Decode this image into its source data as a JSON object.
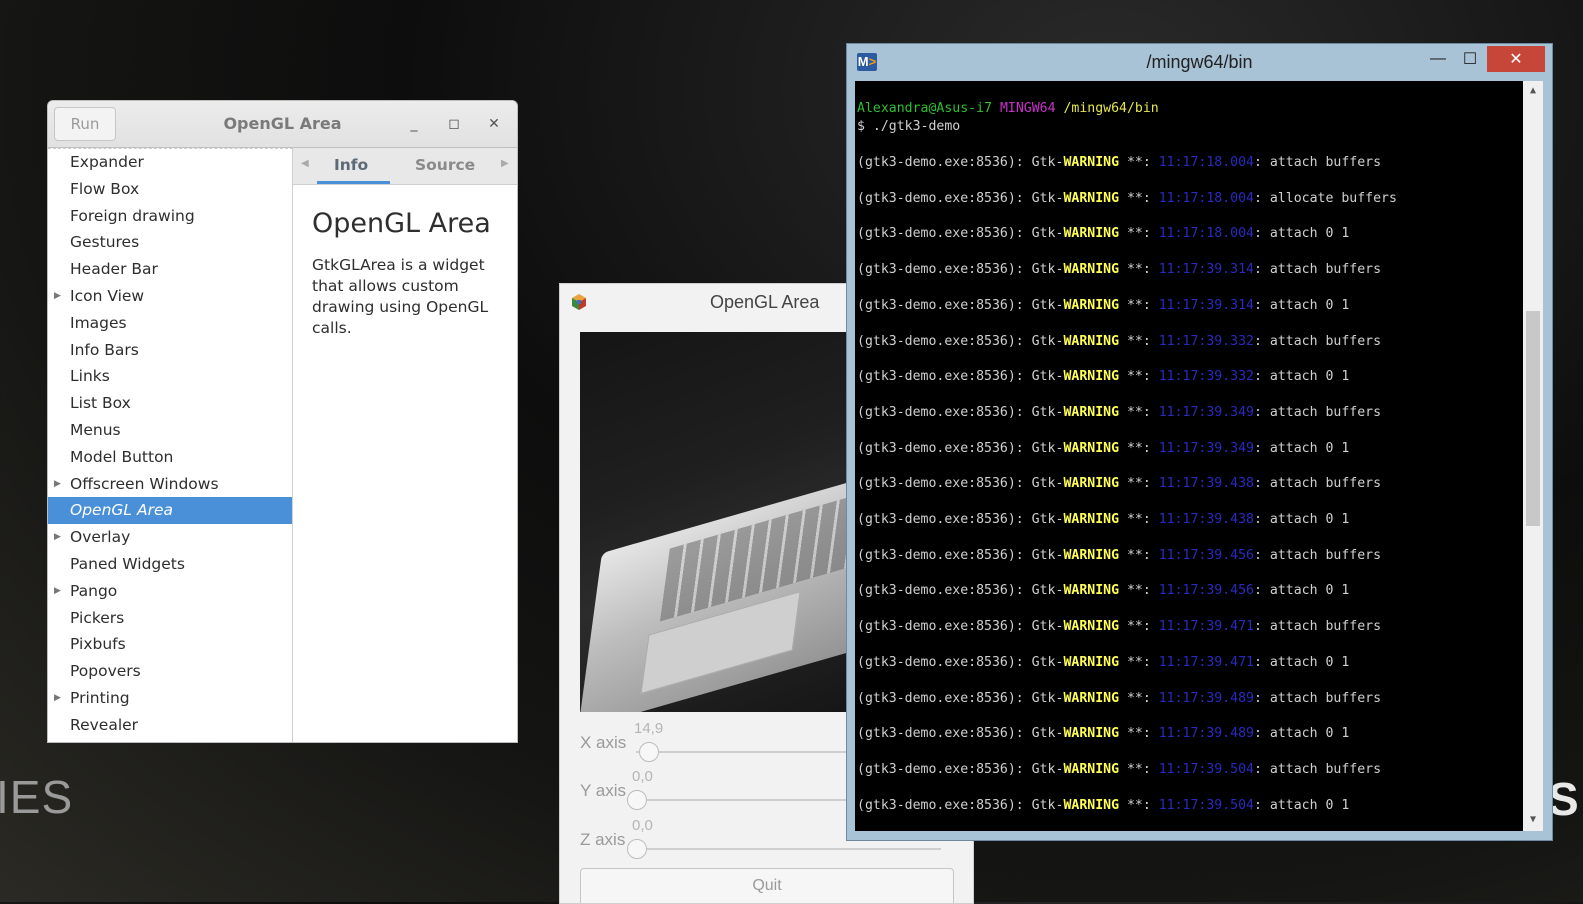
{
  "desktop": {
    "wallpaper_left": "IES",
    "wallpaper_right": "S"
  },
  "gtk_demo": {
    "run_label": "Run",
    "title": "OpenGL Area",
    "minimize": "_",
    "maximize": "◻",
    "close": "✕",
    "sidebar": [
      {
        "label": "Expander",
        "expandable": false
      },
      {
        "label": "Flow Box",
        "expandable": false
      },
      {
        "label": "Foreign drawing",
        "expandable": false
      },
      {
        "label": "Gestures",
        "expandable": false
      },
      {
        "label": "Header Bar",
        "expandable": false
      },
      {
        "label": "Icon View",
        "expandable": true
      },
      {
        "label": "Images",
        "expandable": false
      },
      {
        "label": "Info Bars",
        "expandable": false
      },
      {
        "label": "Links",
        "expandable": false
      },
      {
        "label": "List Box",
        "expandable": false
      },
      {
        "label": "Menus",
        "expandable": false
      },
      {
        "label": "Model Button",
        "expandable": false
      },
      {
        "label": "Offscreen Windows",
        "expandable": true
      },
      {
        "label": "OpenGL Area",
        "expandable": false,
        "selected": true
      },
      {
        "label": "Overlay",
        "expandable": true
      },
      {
        "label": "Paned Widgets",
        "expandable": false
      },
      {
        "label": "Pango",
        "expandable": true
      },
      {
        "label": "Pickers",
        "expandable": false
      },
      {
        "label": "Pixbufs",
        "expandable": false
      },
      {
        "label": "Popovers",
        "expandable": false
      },
      {
        "label": "Printing",
        "expandable": true
      },
      {
        "label": "Revealer",
        "expandable": false
      }
    ],
    "tabs": {
      "info": "Info",
      "source": "Source"
    },
    "info_title": "OpenGL Area",
    "info_text": "GtkGLArea is a widget that allows custom drawing using OpenGL calls."
  },
  "gl_window": {
    "title": "OpenGL Area",
    "x_axis": {
      "label": "X axis",
      "value": "14,9"
    },
    "y_axis": {
      "label": "Y axis",
      "value": "0,0"
    },
    "z_axis": {
      "label": "Z axis",
      "value": "0,0"
    },
    "quit_label": "Quit"
  },
  "terminal": {
    "title": "/mingw64/bin",
    "minimize": "—",
    "maximize": "☐",
    "close": "✕",
    "prompt": {
      "user": "Alexandra@Asus-i7",
      "system": "MINGW64",
      "path": "/mingw64/bin"
    },
    "command": "$ ./gtk3-demo",
    "log_prefix": "(gtk3-demo.exe:8536): Gtk-",
    "log_level": "WARNING",
    "log_sep": " **: ",
    "lines": [
      {
        "time": "11:17:18.004",
        "msg": ": attach buffers"
      },
      {
        "time": "11:17:18.004",
        "msg": ": allocate buffers"
      },
      {
        "time": "11:17:18.004",
        "msg": ": attach 0 1"
      },
      {
        "time": "11:17:39.314",
        "msg": ": attach buffers"
      },
      {
        "time": "11:17:39.314",
        "msg": ": attach 0 1"
      },
      {
        "time": "11:17:39.332",
        "msg": ": attach buffers"
      },
      {
        "time": "11:17:39.332",
        "msg": ": attach 0 1"
      },
      {
        "time": "11:17:39.349",
        "msg": ": attach buffers"
      },
      {
        "time": "11:17:39.349",
        "msg": ": attach 0 1"
      },
      {
        "time": "11:17:39.438",
        "msg": ": attach buffers"
      },
      {
        "time": "11:17:39.438",
        "msg": ": attach 0 1"
      },
      {
        "time": "11:17:39.456",
        "msg": ": attach buffers"
      },
      {
        "time": "11:17:39.456",
        "msg": ": attach 0 1"
      },
      {
        "time": "11:17:39.471",
        "msg": ": attach buffers"
      },
      {
        "time": "11:17:39.471",
        "msg": ": attach 0 1"
      },
      {
        "time": "11:17:39.489",
        "msg": ": attach buffers"
      },
      {
        "time": "11:17:39.489",
        "msg": ": attach 0 1"
      },
      {
        "time": "11:17:39.504",
        "msg": ": attach buffers"
      },
      {
        "time": "11:17:39.504",
        "msg": ": attach 0 1"
      }
    ]
  },
  "colors": {
    "selection": "#4a90d9",
    "warning": "#ffff55",
    "timestamp": "#2a2ac0",
    "prompt_user": "#2fbf2f",
    "prompt_system": "#c930c9"
  }
}
